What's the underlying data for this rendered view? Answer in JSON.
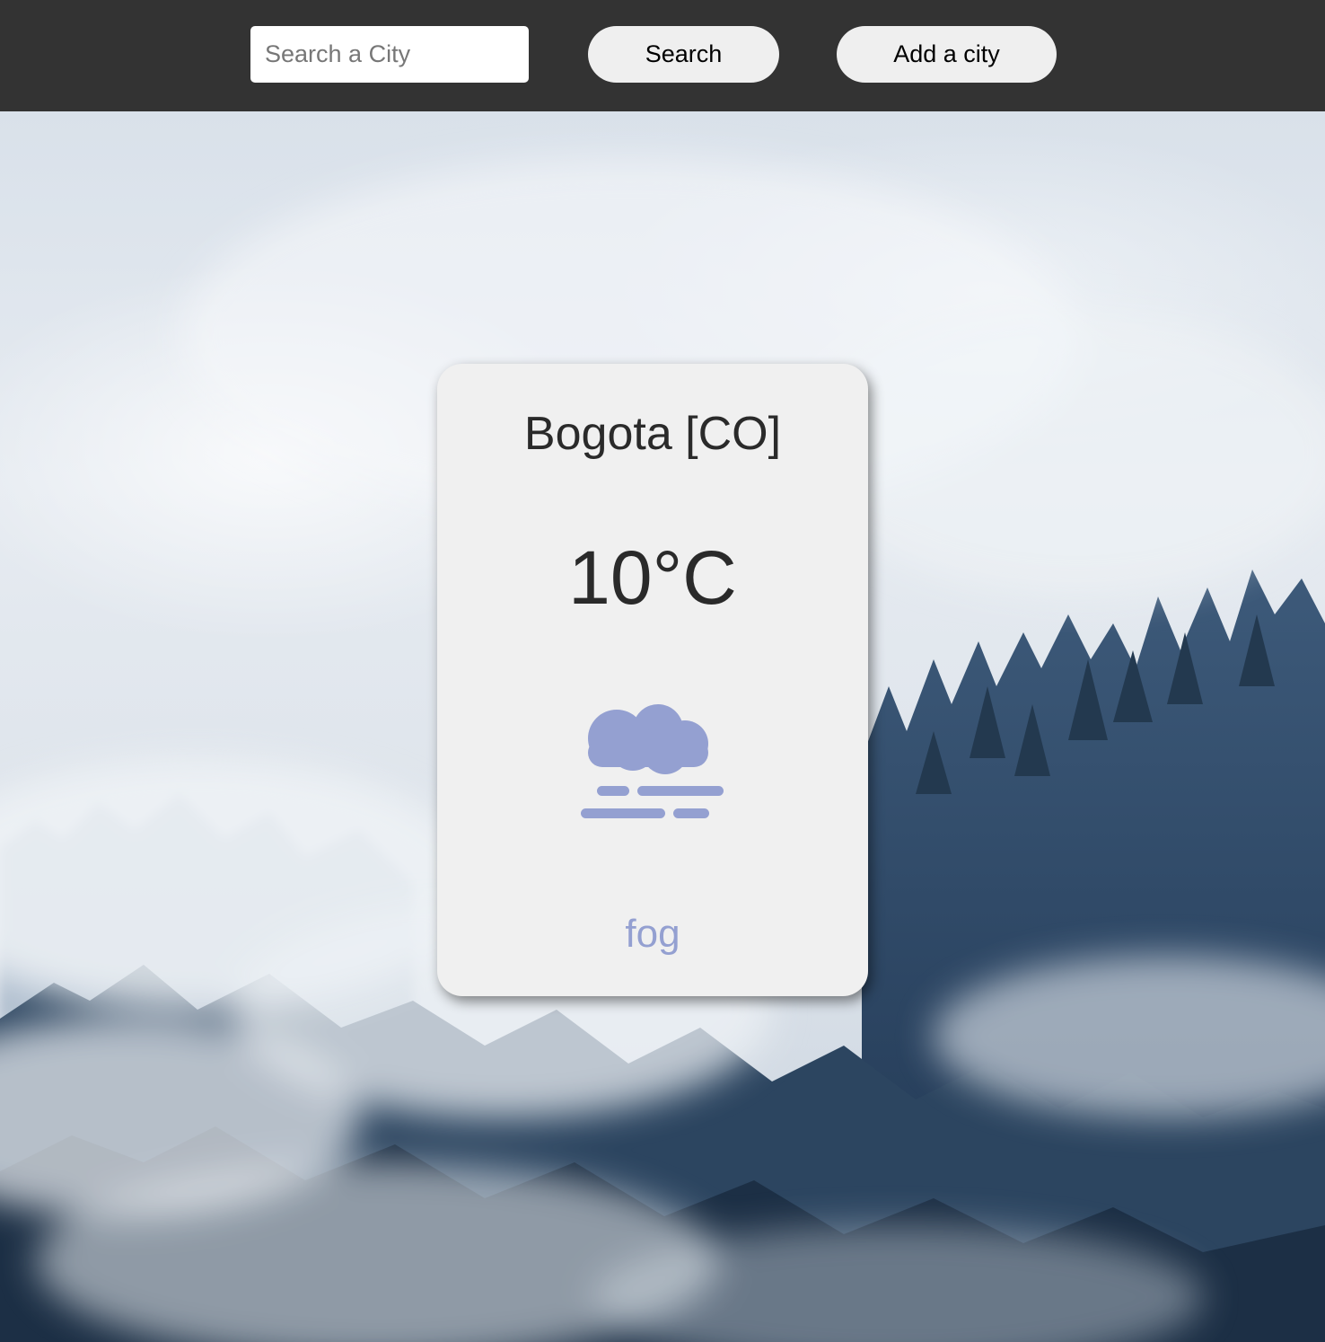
{
  "header": {
    "search": {
      "placeholder": "Search a City",
      "value": ""
    },
    "search_button_label": "Search",
    "add_city_button_label": "Add a city"
  },
  "weather_card": {
    "city": "Bogota [CO]",
    "temperature": "10°C",
    "condition": "fog",
    "icon": "fog-icon",
    "accent_color": "#94a0d1"
  },
  "background": {
    "description_icon": "foggy-forest-photo"
  }
}
